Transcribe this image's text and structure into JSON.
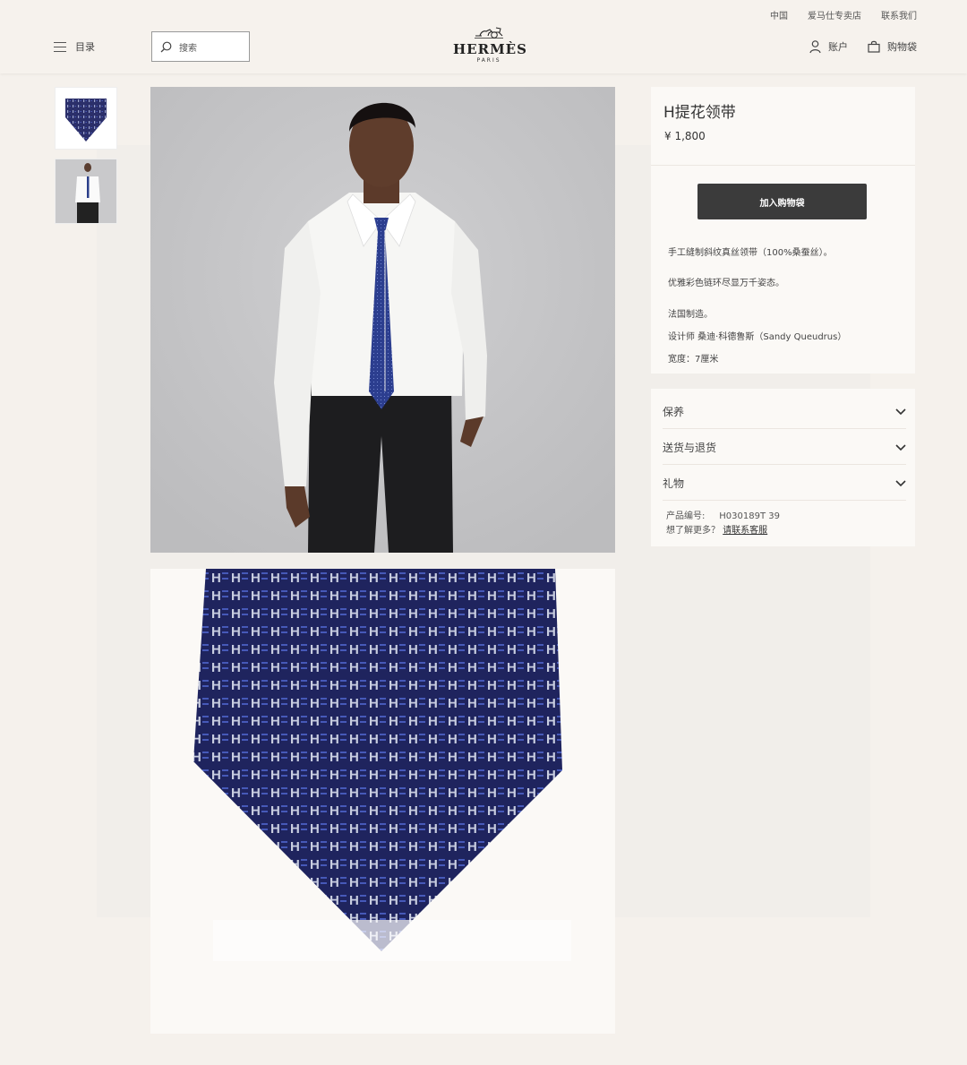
{
  "header": {
    "top_links": [
      "中国",
      "爱马仕专卖店",
      "联系我们"
    ],
    "menu_label": "目录",
    "search_placeholder": "搜索",
    "logo_word": "HERMÈS",
    "logo_city": "PARIS",
    "account_label": "账户",
    "bag_label": "购物袋"
  },
  "product": {
    "title": "H提花领带",
    "price": "¥ 1,800",
    "add_to_bag": "加入购物袋",
    "description": [
      "手工缝制斜纹真丝领带（100%桑蚕丝）。",
      "优雅彩色链环尽显万千姿态。",
      "法国制造。",
      "设计师 桑迪·科德鲁斯（Sandy Queudrus）",
      "宽度：7厘米"
    ]
  },
  "accordion": {
    "items": [
      "保养",
      "送货与退货",
      "礼物"
    ],
    "ref_label": "产品编号:",
    "ref_value": "H030189T 39",
    "more_label": "想了解更多？",
    "contact_link": "请联系客服"
  },
  "colors": {
    "background": "#f5f1ec",
    "button": "#3b3b3b",
    "tie_navy": "#2b2f6a"
  }
}
